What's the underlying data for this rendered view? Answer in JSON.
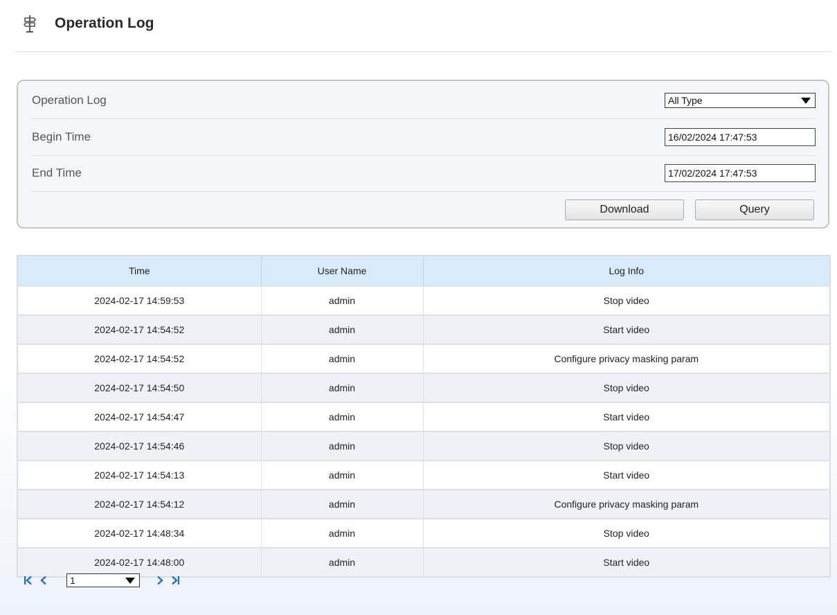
{
  "page": {
    "title": "Operation Log"
  },
  "filter": {
    "type_label": "Operation Log",
    "type_value": "All Type",
    "begin_label": "Begin Time",
    "begin_value": "16/02/2024 17:47:53",
    "end_label": "End Time",
    "end_value": "17/02/2024 17:47:53",
    "download_label": "Download",
    "query_label": "Query"
  },
  "table": {
    "headers": [
      "Time",
      "User Name",
      "Log Info"
    ],
    "rows": [
      [
        "2024-02-17 14:59:53",
        "admin",
        "Stop video"
      ],
      [
        "2024-02-17 14:54:52",
        "admin",
        "Start video"
      ],
      [
        "2024-02-17 14:54:52",
        "admin",
        "Configure privacy masking param"
      ],
      [
        "2024-02-17 14:54:50",
        "admin",
        "Stop video"
      ],
      [
        "2024-02-17 14:54:47",
        "admin",
        "Start video"
      ],
      [
        "2024-02-17 14:54:46",
        "admin",
        "Stop video"
      ],
      [
        "2024-02-17 14:54:13",
        "admin",
        "Start video"
      ],
      [
        "2024-02-17 14:54:12",
        "admin",
        "Configure privacy masking param"
      ],
      [
        "2024-02-17 14:48:34",
        "admin",
        "Stop video"
      ],
      [
        "2024-02-17 14:48:00",
        "admin",
        "Start video"
      ]
    ]
  },
  "pagination": {
    "page_value": "1"
  },
  "colors": {
    "accent": "#1a6fd1",
    "header_bg": "#d8ebfa"
  }
}
